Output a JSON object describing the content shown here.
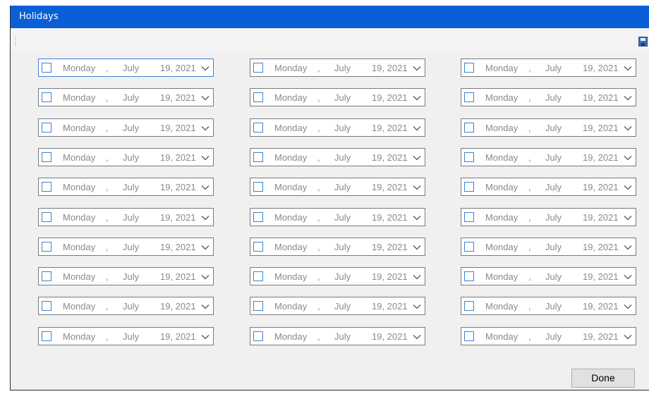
{
  "window": {
    "title": "Holidays"
  },
  "toolbar": {
    "save_icon": "save-icon"
  },
  "date_value": {
    "weekday": "Monday",
    "separator": ",",
    "month": "July",
    "date": "19, 2021"
  },
  "colors": {
    "titlebar": "#0a5fd6",
    "focus_border": "#3e83d2"
  },
  "pickers": [
    {
      "checked": false
    },
    {
      "checked": false
    },
    {
      "checked": false
    },
    {
      "checked": false
    },
    {
      "checked": false
    },
    {
      "checked": false
    },
    {
      "checked": false
    },
    {
      "checked": false
    },
    {
      "checked": false
    },
    {
      "checked": false
    },
    {
      "checked": false
    },
    {
      "checked": false
    },
    {
      "checked": false
    },
    {
      "checked": false
    },
    {
      "checked": false
    },
    {
      "checked": false
    },
    {
      "checked": false
    },
    {
      "checked": false
    },
    {
      "checked": false
    },
    {
      "checked": false
    },
    {
      "checked": false
    },
    {
      "checked": false
    },
    {
      "checked": false
    },
    {
      "checked": false
    },
    {
      "checked": false
    },
    {
      "checked": false
    },
    {
      "checked": false
    },
    {
      "checked": false
    },
    {
      "checked": false
    },
    {
      "checked": false
    }
  ],
  "footer": {
    "done_label": "Done"
  }
}
